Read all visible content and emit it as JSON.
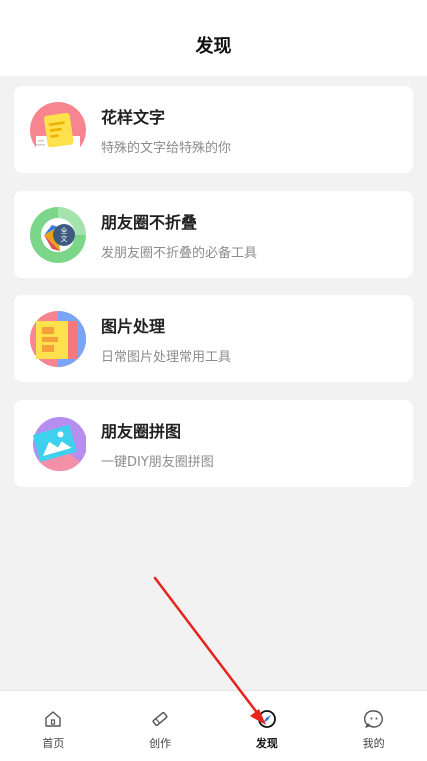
{
  "header": {
    "title": "发现"
  },
  "cards": [
    {
      "title": "花样文字",
      "subtitle": "特殊的文字给特殊的你",
      "icon": "sticky-note-icon"
    },
    {
      "title": "朋友圈不折叠",
      "subtitle": "发朋友圈不折叠的必备工具",
      "icon": "full-text-icon",
      "badge_top": "全",
      "badge_bottom": "文"
    },
    {
      "title": "图片处理",
      "subtitle": "日常图片处理常用工具",
      "icon": "image-editor-icon"
    },
    {
      "title": "朋友圈拼图",
      "subtitle": "一键DIY朋友圈拼图",
      "icon": "picture-collage-icon"
    }
  ],
  "tabbar": {
    "active": "发现",
    "items": [
      {
        "label": "首页",
        "icon": "home-icon"
      },
      {
        "label": "创作",
        "icon": "pencil-icon"
      },
      {
        "label": "发现",
        "icon": "compass-icon"
      },
      {
        "label": "我的",
        "icon": "profile-icon"
      }
    ]
  },
  "colors": {
    "background": "#f2f2f2",
    "card": "#ffffff",
    "annotation_arrow": "#e8231b"
  }
}
